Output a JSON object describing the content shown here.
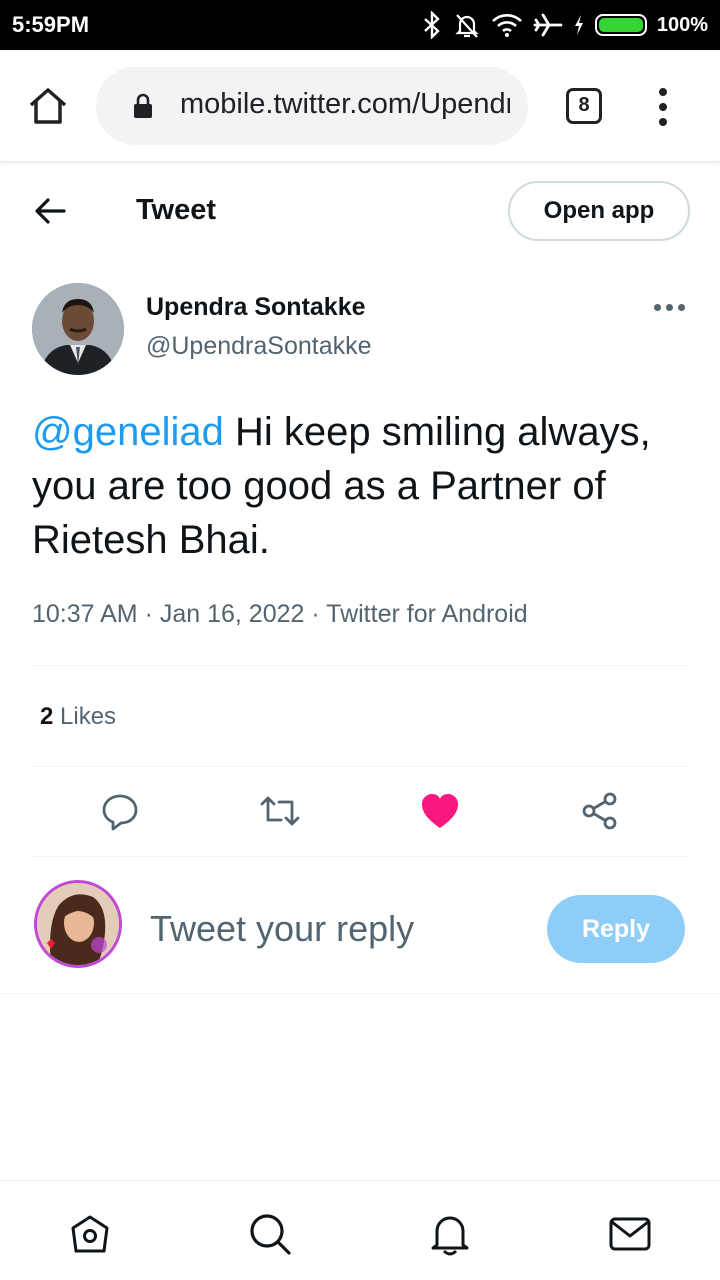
{
  "status_bar": {
    "time": "5:59PM",
    "battery_percent": "100%",
    "icons": [
      "bluetooth-icon",
      "alarm-off-icon",
      "wifi-icon",
      "airplane-icon",
      "charging-icon",
      "battery-icon"
    ]
  },
  "browser": {
    "url": "mobile.twitter.com/UpendraSontakke",
    "tab_count": "8"
  },
  "header": {
    "title": "Tweet",
    "open_app_label": "Open app"
  },
  "tweet": {
    "author_name": "Upendra Sontakke",
    "author_handle": "@UpendraSontakke",
    "mention": "@geneliad",
    "text": " Hi keep smiling always, you are too good as a Partner of Rietesh Bhai.",
    "meta": "10:37 AM · Jan 16, 2022 · Twitter for Android",
    "likes_count": "2",
    "likes_label": " Likes"
  },
  "actions": [
    "reply-icon",
    "retweet-icon",
    "like-icon",
    "share-icon"
  ],
  "reply": {
    "placeholder": "Tweet your reply",
    "button_label": "Reply"
  },
  "colors": {
    "accent": "#1d9bf0",
    "like": "#f91880",
    "reply_button_disabled": "#8ecdf8",
    "secondary_text": "#536471"
  }
}
